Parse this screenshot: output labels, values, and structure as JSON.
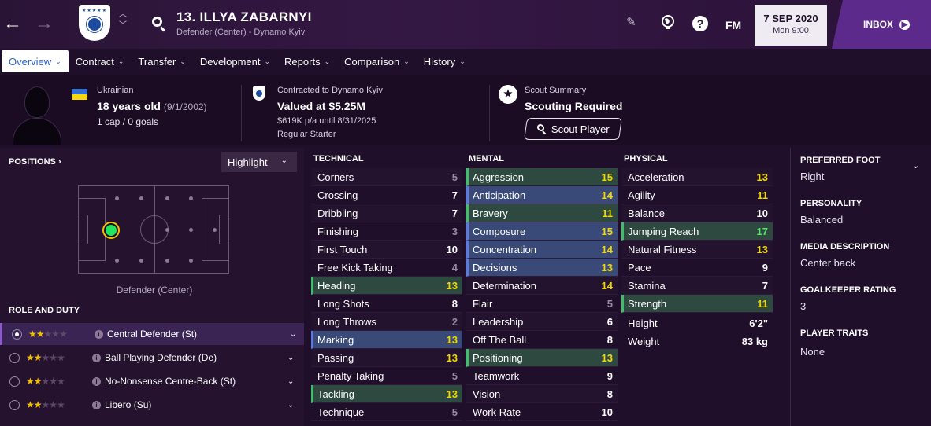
{
  "nav": {
    "back_icon": "←",
    "forward_icon": "→"
  },
  "player": {
    "title": "13. ILLYA ZABARNYI",
    "subtitle": "Defender (Center) - Dynamo Kyiv"
  },
  "toolbar": {
    "fm_label": "FM",
    "help_label": "?"
  },
  "date": {
    "date": "7 SEP 2020",
    "day_time": "Mon 9:00"
  },
  "inbox": {
    "label": "INBOX"
  },
  "tabs": [
    {
      "label": "Overview"
    },
    {
      "label": "Contract"
    },
    {
      "label": "Transfer"
    },
    {
      "label": "Development"
    },
    {
      "label": "Reports"
    },
    {
      "label": "Comparison"
    },
    {
      "label": "History"
    }
  ],
  "info": {
    "nationality": "Ukrainian",
    "age": "18 years old",
    "dob": "(9/1/2002)",
    "caps": "1 cap / 0 goals",
    "contract_club": "Contracted to Dynamo Kyiv",
    "value": "Valued at $5.25M",
    "wage": "$619K p/a until 8/31/2025",
    "squad_status": "Regular Starter",
    "scout_label": "Scout Summary",
    "scout_status": "Scouting Required",
    "scout_button": "Scout Player"
  },
  "positions": {
    "title": "POSITIONS",
    "title_arrow": "›",
    "highlight_label": "Highlight",
    "position_name": "Defender (Center)"
  },
  "roles": {
    "title": "ROLE AND DUTY",
    "items": [
      {
        "name": "Central Defender (St)",
        "stars": 2,
        "selected": true
      },
      {
        "name": "Ball Playing Defender (De)",
        "stars": 2,
        "selected": false
      },
      {
        "name": "No-Nonsense Centre-Back (St)",
        "stars": 2,
        "selected": false
      },
      {
        "name": "Libero (Su)",
        "stars": 2,
        "selected": false
      }
    ]
  },
  "technical": {
    "title": "TECHNICAL",
    "attributes": [
      {
        "name": "Corners",
        "value": "5",
        "hl": ""
      },
      {
        "name": "Crossing",
        "value": "7",
        "hl": ""
      },
      {
        "name": "Dribbling",
        "value": "7",
        "hl": ""
      },
      {
        "name": "Finishing",
        "value": "3",
        "hl": ""
      },
      {
        "name": "First Touch",
        "value": "10",
        "hl": ""
      },
      {
        "name": "Free Kick Taking",
        "value": "4",
        "hl": ""
      },
      {
        "name": "Heading",
        "value": "13",
        "hl": "green"
      },
      {
        "name": "Long Shots",
        "value": "8",
        "hl": ""
      },
      {
        "name": "Long Throws",
        "value": "2",
        "hl": ""
      },
      {
        "name": "Marking",
        "value": "13",
        "hl": "key"
      },
      {
        "name": "Passing",
        "value": "13",
        "hl": ""
      },
      {
        "name": "Penalty Taking",
        "value": "5",
        "hl": ""
      },
      {
        "name": "Tackling",
        "value": "13",
        "hl": "green"
      },
      {
        "name": "Technique",
        "value": "5",
        "hl": ""
      }
    ]
  },
  "mental": {
    "title": "MENTAL",
    "attributes": [
      {
        "name": "Aggression",
        "value": "15",
        "hl": "green"
      },
      {
        "name": "Anticipation",
        "value": "14",
        "hl": "key"
      },
      {
        "name": "Bravery",
        "value": "11",
        "hl": "green"
      },
      {
        "name": "Composure",
        "value": "15",
        "hl": "key"
      },
      {
        "name": "Concentration",
        "value": "14",
        "hl": "key"
      },
      {
        "name": "Decisions",
        "value": "13",
        "hl": "key"
      },
      {
        "name": "Determination",
        "value": "14",
        "hl": ""
      },
      {
        "name": "Flair",
        "value": "5",
        "hl": ""
      },
      {
        "name": "Leadership",
        "value": "6",
        "hl": ""
      },
      {
        "name": "Off The Ball",
        "value": "8",
        "hl": ""
      },
      {
        "name": "Positioning",
        "value": "13",
        "hl": "green"
      },
      {
        "name": "Teamwork",
        "value": "9",
        "hl": ""
      },
      {
        "name": "Vision",
        "value": "8",
        "hl": ""
      },
      {
        "name": "Work Rate",
        "value": "10",
        "hl": ""
      }
    ]
  },
  "physical": {
    "title": "PHYSICAL",
    "attributes": [
      {
        "name": "Acceleration",
        "value": "13",
        "hl": ""
      },
      {
        "name": "Agility",
        "value": "11",
        "hl": ""
      },
      {
        "name": "Balance",
        "value": "10",
        "hl": ""
      },
      {
        "name": "Jumping Reach",
        "value": "17",
        "hl": "green"
      },
      {
        "name": "Natural Fitness",
        "value": "13",
        "hl": ""
      },
      {
        "name": "Pace",
        "value": "9",
        "hl": ""
      },
      {
        "name": "Stamina",
        "value": "7",
        "hl": ""
      },
      {
        "name": "Strength",
        "value": "11",
        "hl": "green"
      }
    ],
    "height_label": "Height",
    "height_value": "6'2\"",
    "weight_label": "Weight",
    "weight_value": "83 kg"
  },
  "details": {
    "preferred_foot_label": "PREFERRED FOOT",
    "preferred_foot": "Right",
    "personality_label": "PERSONALITY",
    "personality": "Balanced",
    "media_label": "MEDIA DESCRIPTION",
    "media": "Center back",
    "gk_label": "GOALKEEPER RATING",
    "gk": "3",
    "traits_label": "PLAYER TRAITS",
    "traits": "None"
  }
}
